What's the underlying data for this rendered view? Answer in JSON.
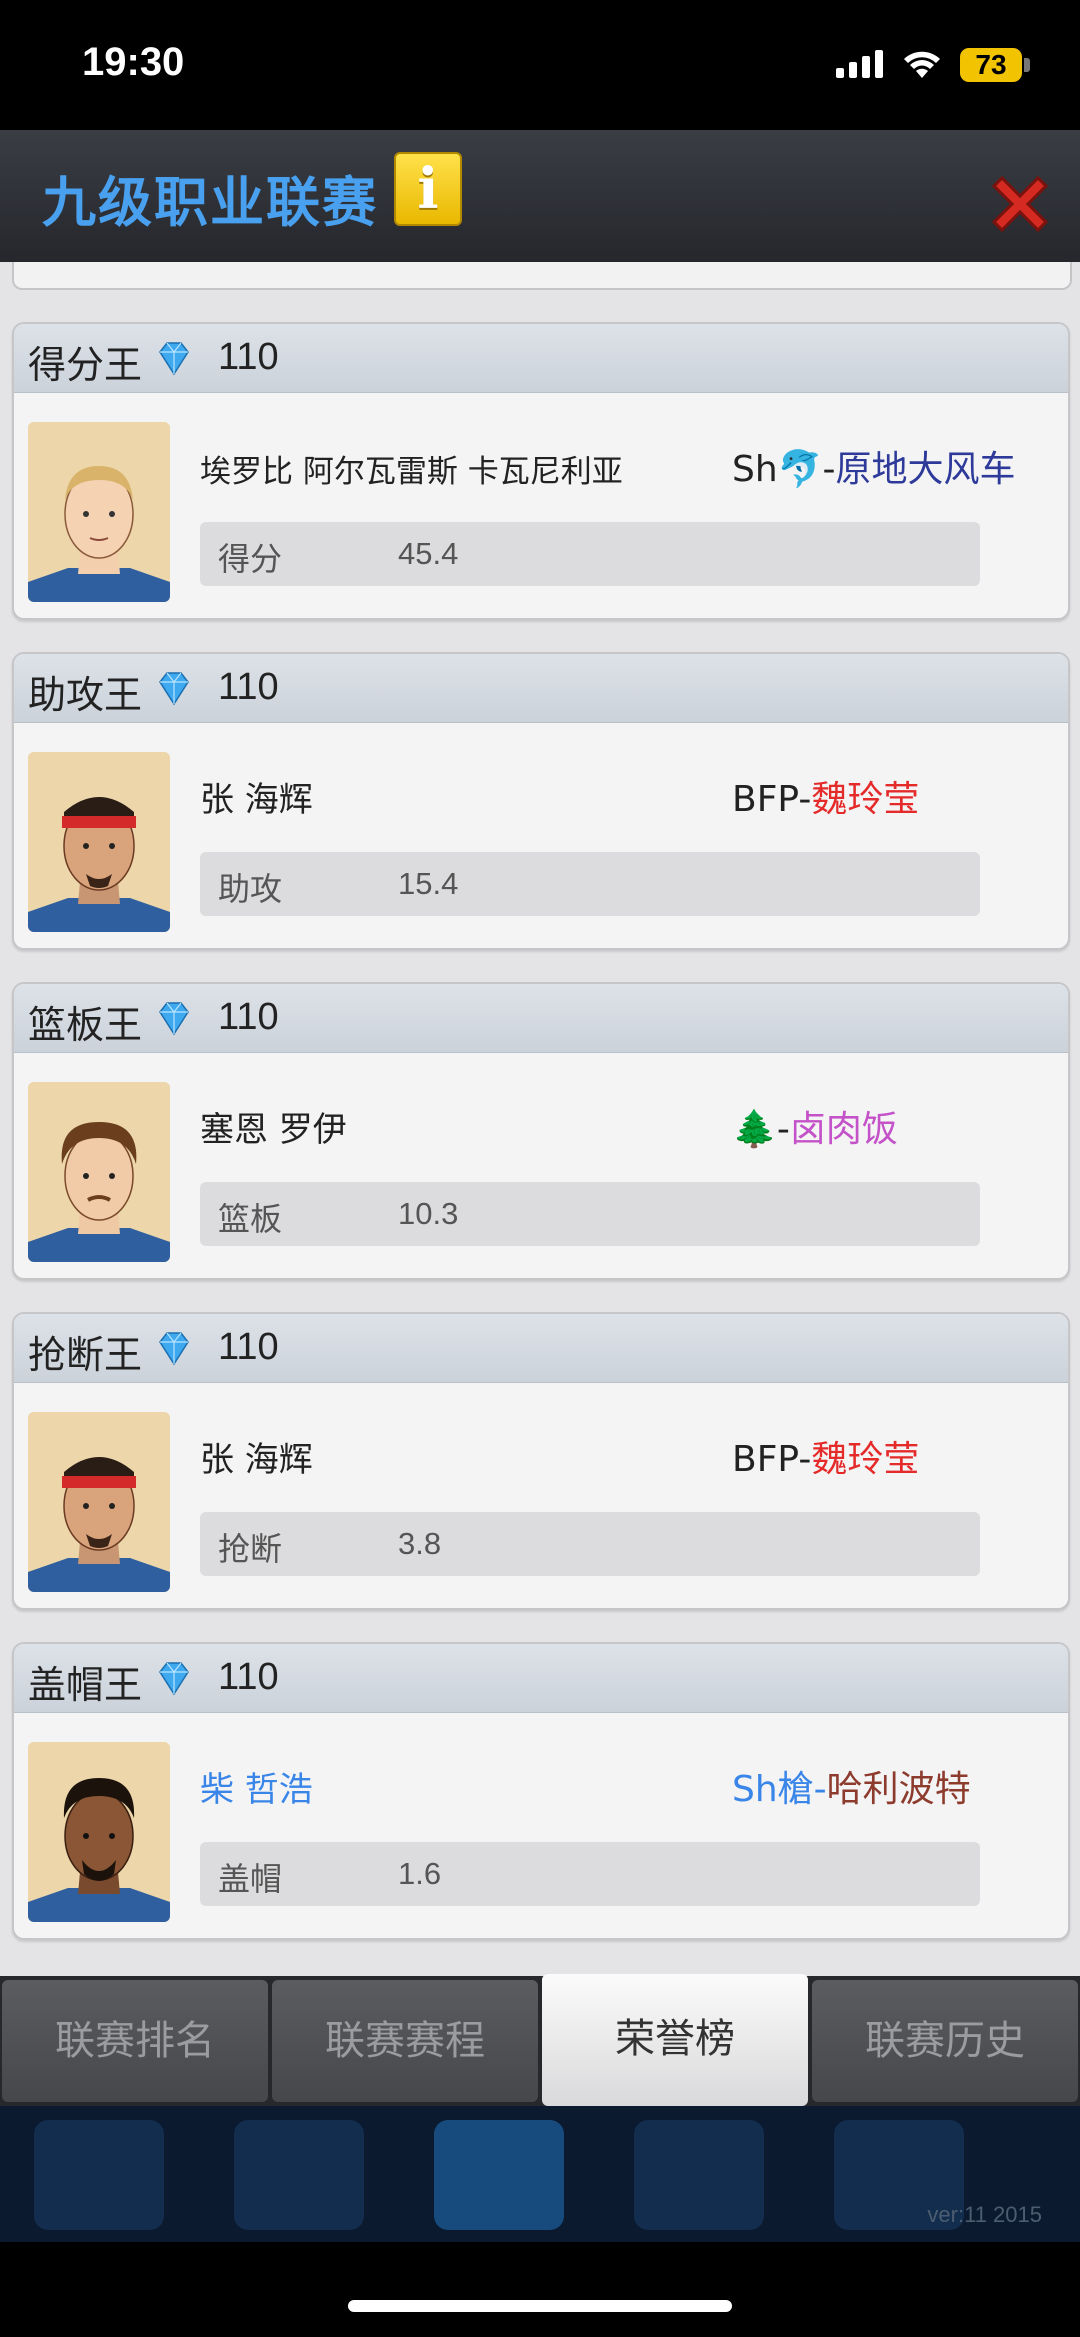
{
  "status": {
    "time": "19:30",
    "battery": "73"
  },
  "header": {
    "title": "九级职业联赛",
    "info_glyph": "i"
  },
  "awards": [
    {
      "title": "得分王",
      "reward": "110",
      "player": "埃罗比 阿尔瓦雷斯 卡瓦尼利亚",
      "team_prefix": "Sh🐬-",
      "team_name": "原地大风车",
      "stat_label": "得分",
      "stat_value": "45.4"
    },
    {
      "title": "助攻王",
      "reward": "110",
      "player": "张 海辉",
      "team_prefix": "BFP-",
      "team_name": "魏玲莹",
      "stat_label": "助攻",
      "stat_value": "15.4"
    },
    {
      "title": "篮板王",
      "reward": "110",
      "player": "塞恩 罗伊",
      "team_prefix": "🌲-",
      "team_name": "卤肉饭",
      "stat_label": "篮板",
      "stat_value": "10.3"
    },
    {
      "title": "抢断王",
      "reward": "110",
      "player": "张 海辉",
      "team_prefix": "BFP-",
      "team_name": "魏玲莹",
      "stat_label": "抢断",
      "stat_value": "3.8"
    },
    {
      "title": "盖帽王",
      "reward": "110",
      "player": "柴 哲浩",
      "team_prefix": "Sh槍-",
      "team_name": "哈利波特",
      "stat_label": "盖帽",
      "stat_value": "1.6"
    }
  ],
  "tabs": [
    "联赛排名",
    "联赛赛程",
    "荣誉榜",
    "联赛历史"
  ],
  "active_tab": "荣誉榜",
  "version": "ver:11  2015",
  "colors": {
    "title_blue": "#49a0ee",
    "team_navy": "#2d3a9a",
    "team_red": "#e52a2a",
    "team_pink": "#c452c8",
    "team_brown": "#8c3b2c",
    "player_blue": "#3a86e8"
  }
}
